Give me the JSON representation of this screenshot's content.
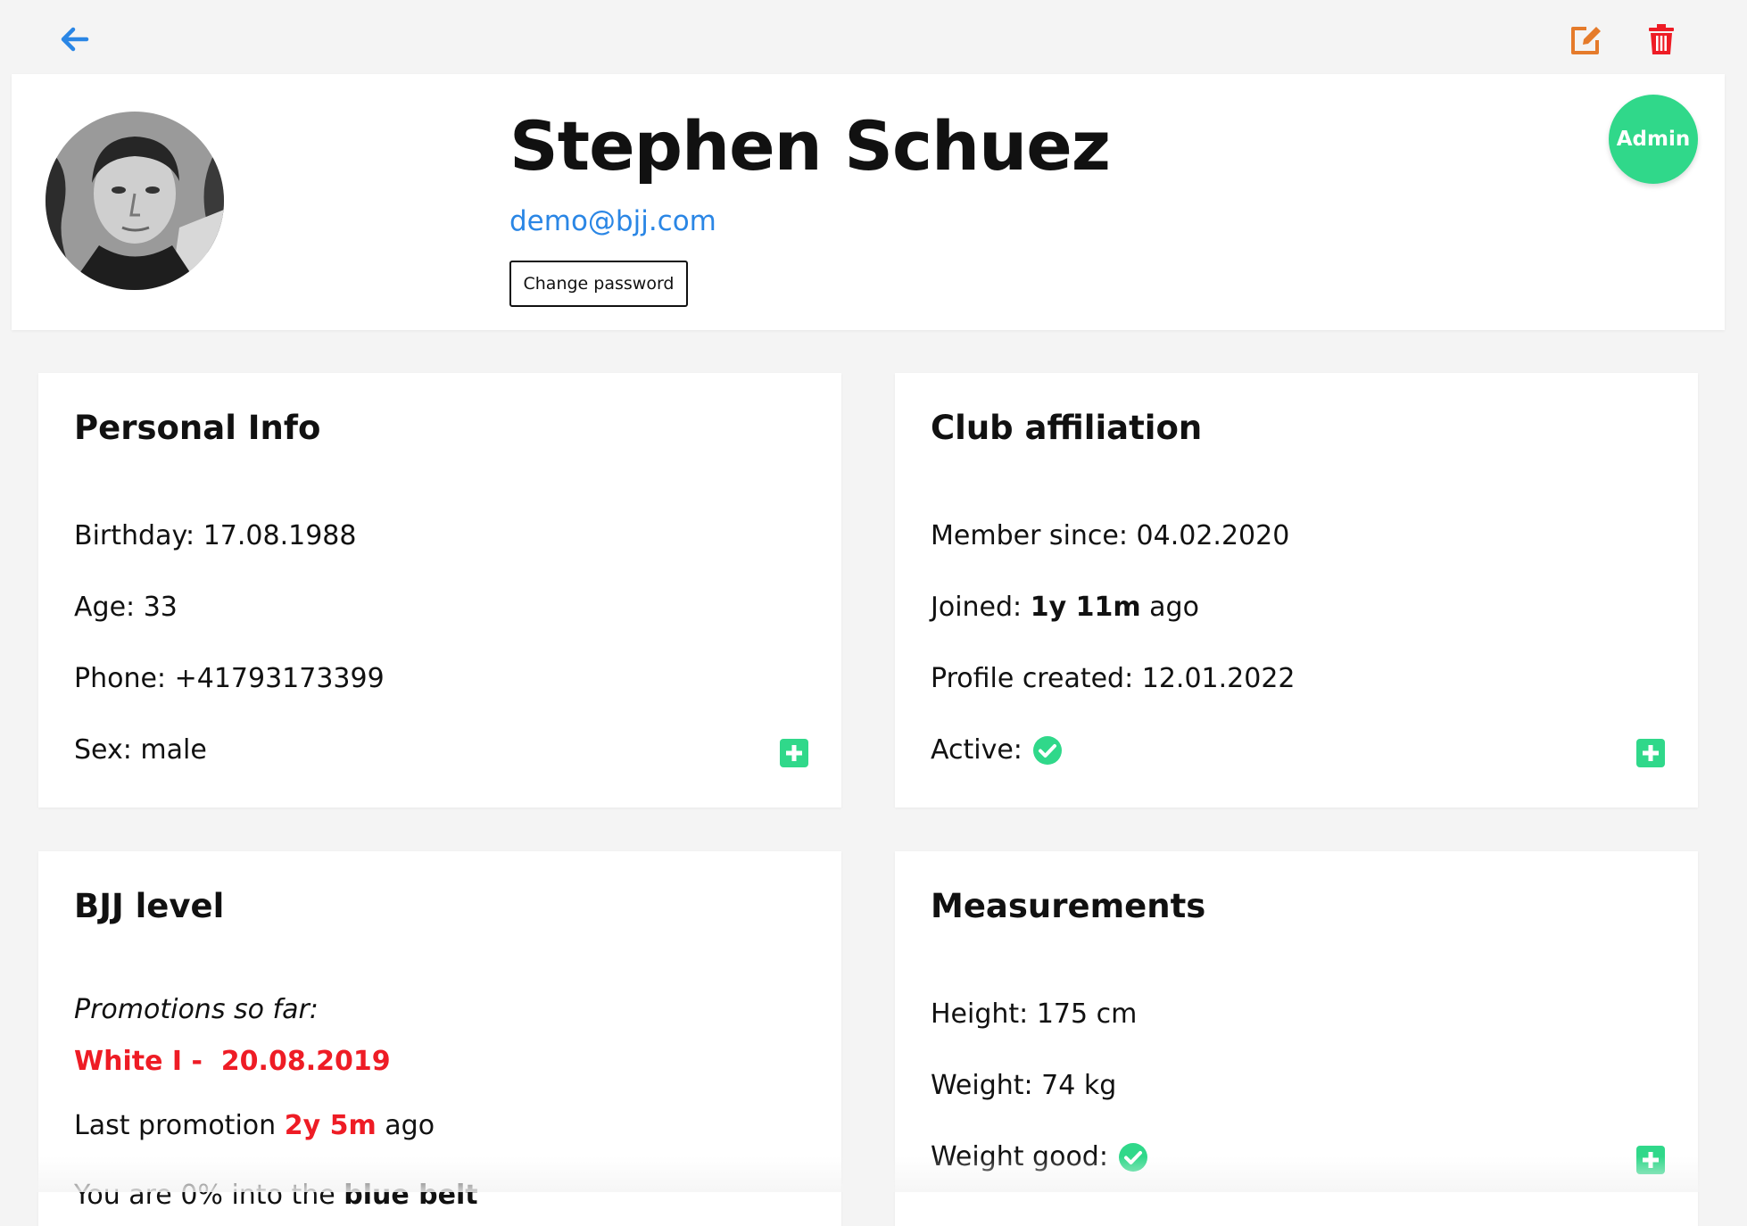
{
  "colors": {
    "accent_blue": "#2a86e5",
    "edit_orange": "#e57b2b",
    "delete_red": "#ee1c25",
    "admin_green": "#30d88a",
    "success_green": "#30d88a",
    "highlight_red": "#ee1c25"
  },
  "toolbar": {
    "back_icon": "arrow-left-icon",
    "edit_icon": "edit-icon",
    "delete_icon": "trash-icon"
  },
  "profile": {
    "name": "Stephen Schuez",
    "email": "demo@bjj.com",
    "change_password_label": "Change password",
    "role_badge": "Admin"
  },
  "personal_info": {
    "title": "Personal Info",
    "birthday_label": "Birthday:",
    "birthday": "17.08.1988",
    "age_label": "Age:",
    "age": "33",
    "phone_label": "Phone:",
    "phone": "+41793173399",
    "sex_label": "Sex:",
    "sex": "male"
  },
  "club": {
    "title": "Club affiliation",
    "member_since_label": "Member since:",
    "member_since": "04.02.2020",
    "joined_label": "Joined:",
    "joined_value": "1y 11m",
    "joined_suffix": "ago",
    "profile_created_label": "Profile created:",
    "profile_created": "12.01.2022",
    "active_label": "Active:"
  },
  "bjj": {
    "title": "BJJ level",
    "promotions_label": "Promotions so far:",
    "promotion_entry": "White I -  20.08.2019",
    "last_promotion_label": "Last promotion",
    "last_promotion_value": "2y 5m",
    "last_promotion_suffix": "ago",
    "progress_prefix": "You are",
    "progress_percent": "0%",
    "progress_middle": "into the",
    "next_belt": "blue belt"
  },
  "measurements": {
    "title": "Measurements",
    "height_label": "Height:",
    "height": "175 cm",
    "weight_label": "Weight:",
    "weight": "74 kg",
    "weight_good_label": "Weight good:"
  }
}
